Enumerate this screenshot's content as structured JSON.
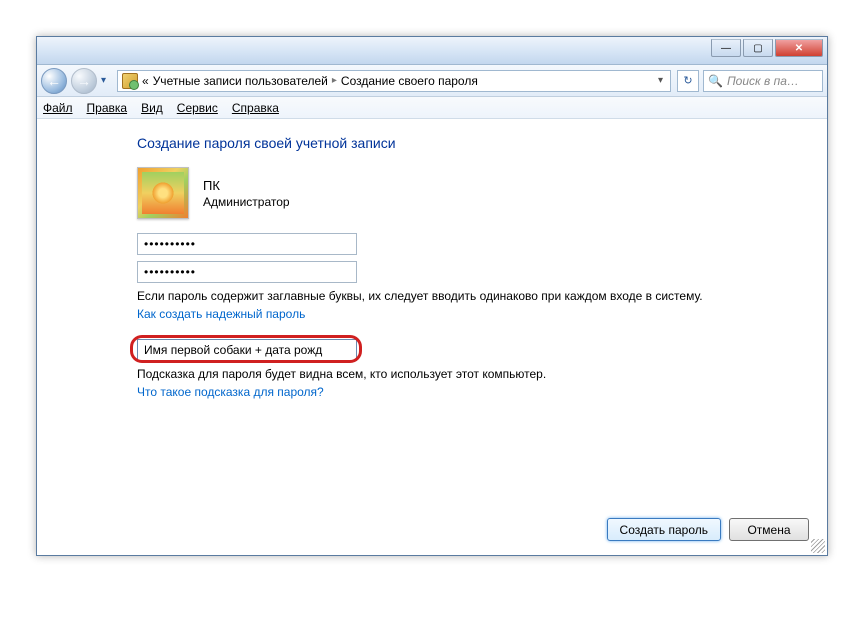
{
  "titlebar": {
    "min": "—",
    "max": "▢",
    "close": "✕"
  },
  "nav": {
    "back_glyph": "←",
    "fwd_glyph": "→",
    "chev": "▾",
    "crumb_prefix": "«",
    "crumb1": "Учетные записи пользователей",
    "crumb_sep": "▸",
    "crumb2": "Создание своего пароля",
    "drop": "▾",
    "refresh": "↻",
    "search_placeholder": "Поиск в па…",
    "search_icon": "🔍"
  },
  "menu": {
    "file": "Файл",
    "edit": "Правка",
    "view": "Вид",
    "tools": "Сервис",
    "help": "Справка"
  },
  "page": {
    "title": "Создание пароля своей учетной записи",
    "username": "ПК",
    "role": "Администратор",
    "pw1": "●●●●●●●●●●",
    "pw2": "●●●●●●●●●●",
    "pw_note": "Если пароль содержит заглавные буквы, их следует вводить одинаково при каждом входе в систему.",
    "link1": "Как создать надежный пароль",
    "hint_value": "Имя первой собаки + дата рожд",
    "hint_note": "Подсказка для пароля будет видна всем, кто использует этот компьютер.",
    "link2": "Что такое подсказка для пароля?",
    "btn_create": "Создать пароль",
    "btn_cancel": "Отмена"
  }
}
